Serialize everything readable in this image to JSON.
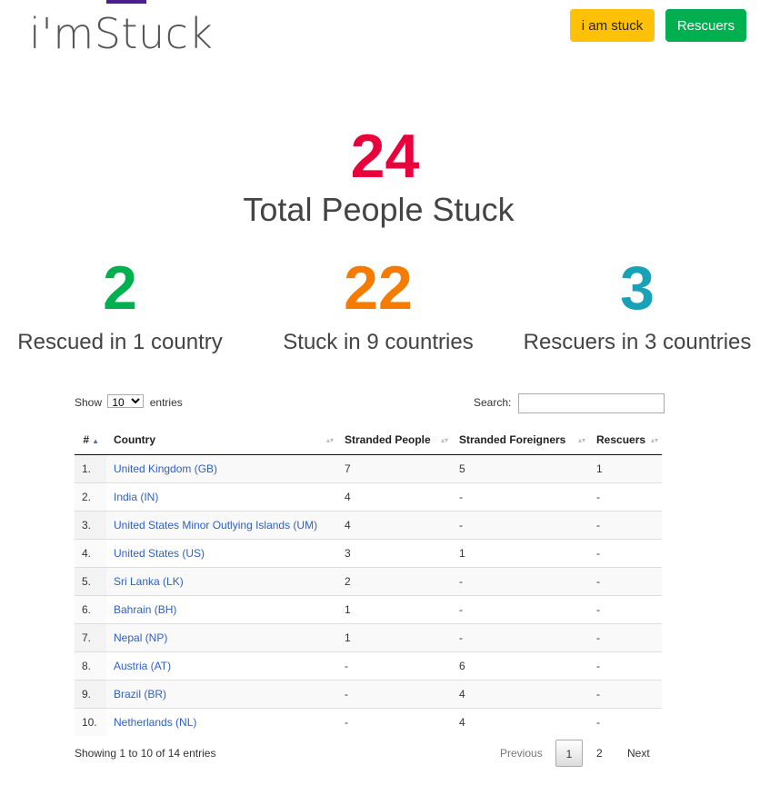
{
  "header": {
    "logo": "i'mStuck",
    "stuck_button": "i am stuck",
    "rescuers_button": "Rescuers"
  },
  "colors": {
    "accent_purple": "#4b1d8f",
    "total_red": "#e8003c",
    "rescued_green": "#00b050",
    "stuck_orange": "#f57c00",
    "rescuers_teal": "#17a2b8",
    "stuck_button_yellow": "#ffc107",
    "link_blue": "#2f61c2"
  },
  "totals": {
    "total_number": "24",
    "total_label": "Total People Stuck"
  },
  "stats": [
    {
      "number": "2",
      "label": "Rescued in 1 country"
    },
    {
      "number": "22",
      "label": "Stuck in 9 countries"
    },
    {
      "number": "3",
      "label": "Rescuers in 3 countries"
    }
  ],
  "table_controls": {
    "show_prefix": "Show",
    "page_length": "10",
    "show_suffix": "entries",
    "search_label": "Search:",
    "search_value": ""
  },
  "table": {
    "columns": [
      "#",
      "Country",
      "Stranded People",
      "Stranded Foreigners",
      "Rescuers"
    ],
    "rows": [
      {
        "n": "1.",
        "country": "United Kingdom (GB)",
        "people": "7",
        "foreigners": "5",
        "rescuers": "1"
      },
      {
        "n": "2.",
        "country": "India (IN)",
        "people": "4",
        "foreigners": "-",
        "rescuers": "-"
      },
      {
        "n": "3.",
        "country": "United States Minor Outlying Islands (UM)",
        "people": "4",
        "foreigners": "-",
        "rescuers": "-"
      },
      {
        "n": "4.",
        "country": "United States (US)",
        "people": "3",
        "foreigners": "1",
        "rescuers": "-"
      },
      {
        "n": "5.",
        "country": "Sri Lanka (LK)",
        "people": "2",
        "foreigners": "-",
        "rescuers": "-"
      },
      {
        "n": "6.",
        "country": "Bahrain (BH)",
        "people": "1",
        "foreigners": "-",
        "rescuers": "-"
      },
      {
        "n": "7.",
        "country": "Nepal (NP)",
        "people": "1",
        "foreigners": "-",
        "rescuers": "-"
      },
      {
        "n": "8.",
        "country": "Austria (AT)",
        "people": "-",
        "foreigners": "6",
        "rescuers": "-"
      },
      {
        "n": "9.",
        "country": "Brazil (BR)",
        "people": "-",
        "foreigners": "4",
        "rescuers": "-"
      },
      {
        "n": "10.",
        "country": "Netherlands (NL)",
        "people": "-",
        "foreigners": "4",
        "rescuers": "-"
      }
    ]
  },
  "footer": {
    "info": "Showing 1 to 10 of 14 entries",
    "previous": "Previous",
    "page1": "1",
    "page2": "2",
    "next": "Next"
  }
}
